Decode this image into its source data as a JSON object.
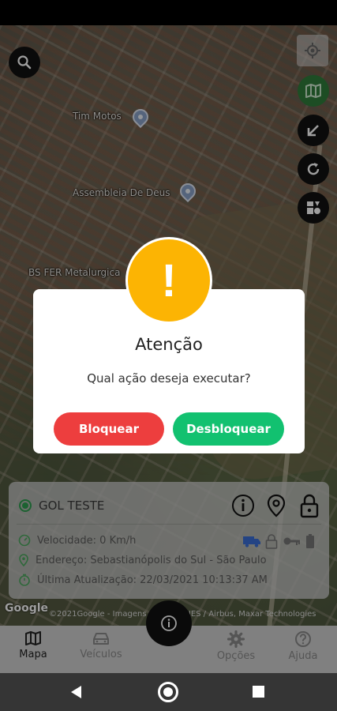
{
  "map": {
    "labels": [
      "Tim Motos",
      "Assembleia De Deus",
      "BS FER Metalurgica"
    ],
    "attribution": "©2021Google - Imagens ©2021 CNES / Airbus, Maxar Technologies",
    "google_logo": "Google"
  },
  "controls": {
    "search_icon": "search-icon",
    "locate_icon": "crosshair-icon",
    "map_type_icon": "map-icon",
    "collapse_icon": "arrow-down-left-icon",
    "refresh_icon": "refresh-icon",
    "layers_icon": "shapes-icon"
  },
  "dialog": {
    "icon": "!",
    "title": "Atenção",
    "message": "Qual ação deseja executar?",
    "block_label": "Bloquear",
    "unblock_label": "Desbloquear",
    "colors": {
      "alert": "#fcb403",
      "block": "#ed3e3e",
      "unblock": "#12c170"
    }
  },
  "vehicle_card": {
    "name": "GOL TESTE",
    "speed": "Velocidade: 0 Km/h",
    "address": "Endereço: Sebastianópolis do Sul - São Paulo",
    "last_update": "Última Atualização: 22/03/2021 10:13:37 AM",
    "status_color": "#2e9f4f"
  },
  "bottom_nav": {
    "items": [
      {
        "label": "Mapa",
        "icon": "map-icon"
      },
      {
        "label": "Veículos",
        "icon": "car-icon"
      },
      {
        "label": "Opções",
        "icon": "gear-icon"
      },
      {
        "label": "Ajuda",
        "icon": "help-icon"
      }
    ],
    "fab_icon": "info-icon"
  }
}
